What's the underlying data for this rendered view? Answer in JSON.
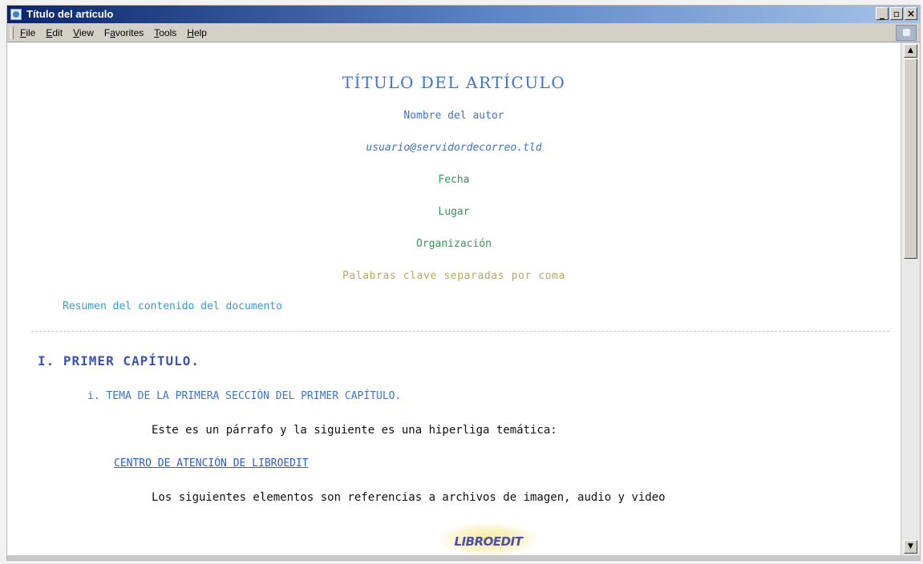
{
  "window": {
    "title": "Título del artículo",
    "buttons": {
      "minimize": "_",
      "maximize": "▫",
      "close": "×"
    }
  },
  "menu": {
    "items": [
      {
        "key": "F",
        "rest": "ile"
      },
      {
        "key": "E",
        "rest": "dit"
      },
      {
        "key": "V",
        "rest": "iew"
      },
      {
        "pre": "F",
        "key": "a",
        "rest": "vorites"
      },
      {
        "key": "T",
        "rest": "ools"
      },
      {
        "key": "H",
        "rest": "elp"
      }
    ]
  },
  "document": {
    "title": "TÍTULO DEL ARTÍCULO",
    "author": "Nombre del autor",
    "email": "usuario@servidordecorreo.tld",
    "date": "Fecha",
    "place": "Lugar",
    "organization": "Organización",
    "keywords": "Palabras clave separadas por coma",
    "abstract": "Resumen del contenido del documento",
    "chapter": "I. PRIMER CAPÍTULO.",
    "section": "i. TEMA DE LA PRIMERA SECCIÓN DEL PRIMER CAPÍTULO.",
    "paragraph1": "Este es un párrafo y la siguiente es una hiperliga temática:",
    "link": "CENTRO DE ATENCIÓN DE LIBROEDIT",
    "paragraph2": "Los siguientes elementos son referencias a archivos de imagen, audio y video",
    "logo": "LIBROEDIT"
  },
  "colors": {
    "title_blue": "#3a73d6",
    "green": "#2e9a4e",
    "keywords_olive": "#b6aa55",
    "abstract_cyan": "#2a9fd8",
    "chapter_blue": "#3b55b5"
  },
  "icons": {
    "app": "ie-document-icon",
    "scroll_up": "arrow-up-icon",
    "scroll_down": "arrow-down-icon"
  }
}
